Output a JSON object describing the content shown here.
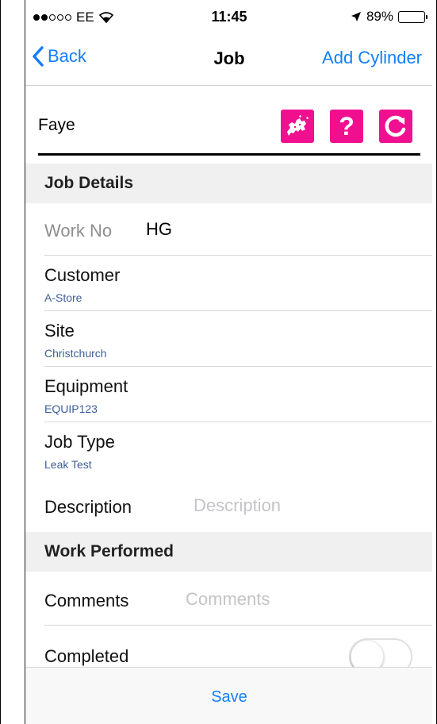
{
  "status": {
    "carrier": "EE",
    "time": "11:45",
    "battery": "89%",
    "battery_level": 0.89
  },
  "nav": {
    "back_label": "Back",
    "title": "Job",
    "right_label": "Add Cylinder"
  },
  "user": {
    "name": "Faye"
  },
  "icons": {
    "map": "europe-map-icon",
    "help": "question-icon",
    "refresh": "refresh-icon",
    "accent": "#f0108f"
  },
  "sections": {
    "job_details": "Job Details",
    "work_performed": "Work Performed"
  },
  "job": {
    "work_no_label": "Work No",
    "work_no_value": "HG",
    "customer_label": "Customer",
    "customer_value": "A-Store",
    "site_label": "Site",
    "site_value": "Christchurch",
    "equipment_label": "Equipment",
    "equipment_value": "EQUIP123",
    "job_type_label": "Job Type",
    "job_type_value": "Leak Test",
    "description_label": "Description",
    "description_placeholder": "Description"
  },
  "work": {
    "comments_label": "Comments",
    "comments_placeholder": "Comments",
    "completed_label": "Completed",
    "completed_on": false
  },
  "footer": {
    "save_label": "Save"
  },
  "colors": {
    "tint": "#147efb",
    "subtitle": "#3d5f96"
  }
}
